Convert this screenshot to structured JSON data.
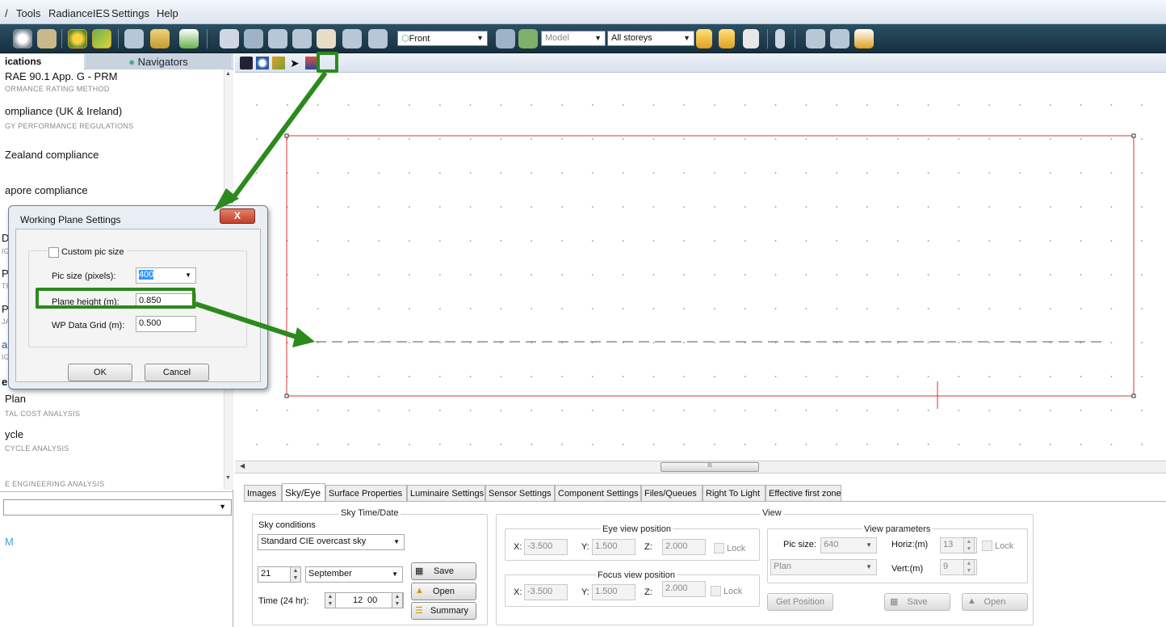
{
  "menubar": {
    "items": [
      "Tools",
      "RadianceIES",
      "Settings",
      "Help"
    ]
  },
  "toolbar": {
    "view_select": "Front",
    "mode_select": "Model",
    "storey_select": "All storeys",
    "icons": [
      "view-icon",
      "apps-icon",
      "navigator-icon",
      "model-icon",
      "component-icon",
      "list-icon",
      "layers-icon",
      "zoom-extents-icon",
      "zoom-window-icon",
      "zoom-in-icon",
      "zoom-out-icon",
      "pan-icon",
      "rotate-icon",
      "rotate-back-icon",
      "prev-icon",
      "next-icon",
      "up-icon",
      "down-icon",
      "page-icon",
      "north-icon",
      "axis-icon",
      "orbit-icon",
      "render-icon"
    ]
  },
  "left_panel": {
    "tab_applications": "ications",
    "tab_navigators": "Navigators",
    "items": [
      {
        "title": "RAE 90.1 App. G - PRM",
        "subtitle": "ORMANCE RATING METHOD"
      },
      {
        "title": "ompliance (UK & Ireland)",
        "subtitle": "GY PERFORMANCE REGULATIONS"
      },
      {
        "title": "Zealand compliance",
        "subtitle": ""
      },
      {
        "title": "apore compliance",
        "subtitle": ""
      },
      {
        "title": "DL",
        "subtitle": "IG"
      },
      {
        "title": "Pr",
        "subtitle": "TR"
      },
      {
        "title": "Pr",
        "subtitle": "JAI"
      },
      {
        "title": "ani",
        "subtitle": "IG"
      },
      {
        "title": "e",
        "subtitle": ""
      },
      {
        "title": "Plan",
        "subtitle": "TAL COST ANALYSIS"
      },
      {
        "title": "ycle",
        "subtitle": "CYCLE ANALYSIS"
      },
      {
        "title": "",
        "subtitle": "E ENGINEERING ANALYSIS"
      }
    ],
    "m_item": "M"
  },
  "canvas_toolbar": {
    "icons": [
      "save-icon",
      "zoom-icon",
      "pick-icon",
      "pointer-icon",
      "working-plane-icon"
    ]
  },
  "scroll": {
    "thumb": "III"
  },
  "dialog": {
    "title": "Working Plane Settings",
    "close": "X",
    "custom_pic_size": "Custom pic size",
    "pic_size_label": "Pic size (pixels):",
    "pic_size_value": "400",
    "plane_height_label": "Plane height (m):",
    "plane_height_value": "0.850",
    "wp_grid_label": "WP Data Grid (m):",
    "wp_grid_value": "0.500",
    "ok": "OK",
    "cancel": "Cancel"
  },
  "bottom_tabs": [
    "Images",
    "Sky/Eye",
    "Surface Properties",
    "Luminaire Settings",
    "Sensor Settings",
    "Component Settings",
    "Files/Queues",
    "Right To Light",
    "Effective first zone"
  ],
  "sky": {
    "group_title": "Sky Time/Date",
    "conditions_label": "Sky conditions",
    "conditions_value": "Standard CIE overcast sky",
    "day": "21",
    "month": "September",
    "time_label": "Time (24 hr):",
    "hour": "12",
    "minute": "00",
    "save": "Save",
    "open": "Open",
    "summary": "Summary"
  },
  "view": {
    "group_title": "View",
    "eye_title": "Eye view position",
    "eye_x": "-3.500",
    "eye_y": "1.500",
    "eye_z": "2.000",
    "focus_title": "Focus view position",
    "focus_x": "-3.500",
    "focus_y": "1.500",
    "focus_z": "2.000",
    "x_label": "X:",
    "y_label": "Y:",
    "z_label": "Z:",
    "lock": "Lock",
    "get_position": "Get Position",
    "params_title": "View parameters",
    "pic_size_label": "Pic size:",
    "pic_size_value": "640",
    "projection": "Plan",
    "horiz_label": "Horiz:(m)",
    "horiz_value": "13",
    "vert_label": "Vert:(m)",
    "vert_value": "9",
    "save": "Save",
    "open": "Open"
  }
}
